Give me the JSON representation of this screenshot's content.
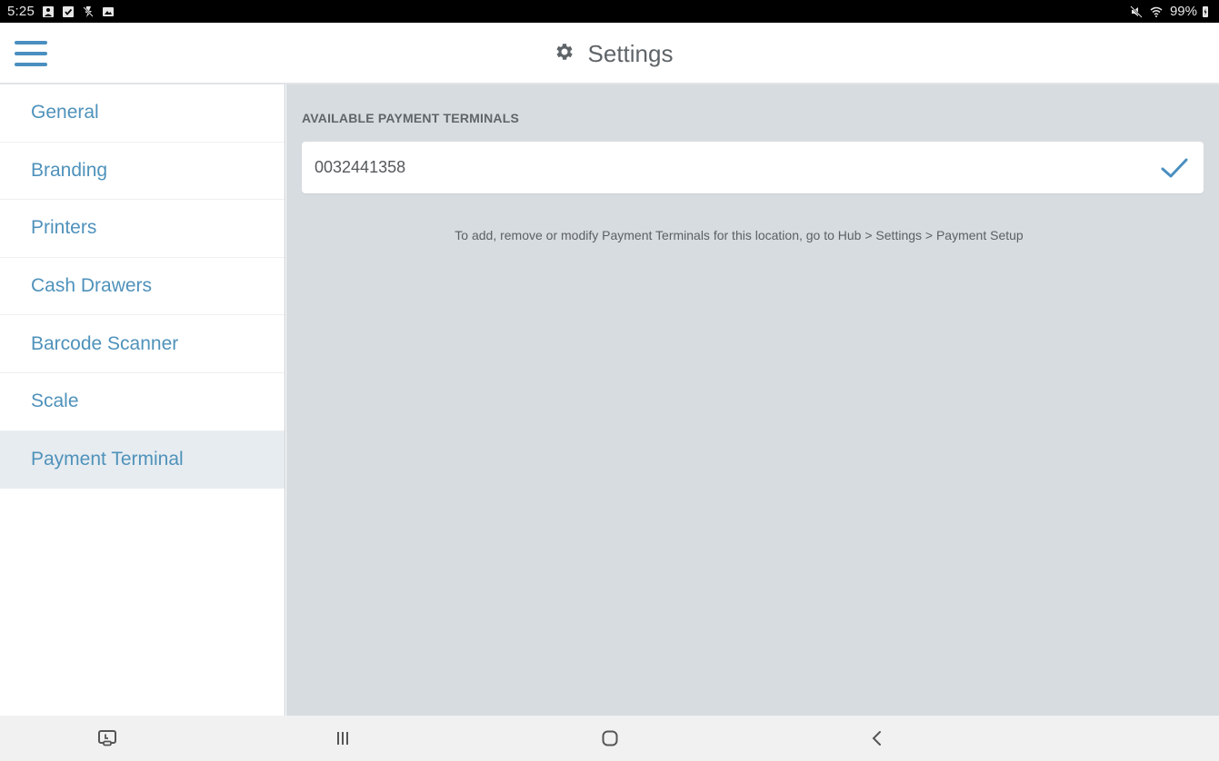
{
  "status_bar": {
    "time": "5:25",
    "left_icons": [
      "screenshot-icon",
      "checkbox-icon",
      "no-flash-icon",
      "image-icon"
    ],
    "right_icons": [
      "mute-icon",
      "wifi-icon",
      "battery-icon"
    ],
    "battery": "99%"
  },
  "header": {
    "menu_icon": "hamburger-menu-icon",
    "title_icon": "gear-icon",
    "title": "Settings"
  },
  "sidebar": {
    "items": [
      {
        "label": "General",
        "active": false
      },
      {
        "label": "Branding",
        "active": false
      },
      {
        "label": "Printers",
        "active": false
      },
      {
        "label": "Cash Drawers",
        "active": false
      },
      {
        "label": "Barcode Scanner",
        "active": false
      },
      {
        "label": "Scale",
        "active": false
      },
      {
        "label": "Payment Terminal",
        "active": true
      }
    ]
  },
  "main": {
    "section_label": "AVAILABLE PAYMENT TERMINALS",
    "terminals": [
      {
        "id": "0032441358",
        "selected": true
      }
    ],
    "help_text": "To add, remove or modify Payment Terminals for this location, go to Hub > Settings > Payment Setup"
  },
  "nav_bar": {
    "buttons": [
      "screen-mirror-icon",
      "recent-apps-icon",
      "home-icon",
      "back-icon"
    ]
  },
  "colors": {
    "accent": "#4a8fc0",
    "sidebar_text": "#4f92bb",
    "content_bg": "#d7dce0",
    "active_item_bg": "#e7ecf0"
  }
}
